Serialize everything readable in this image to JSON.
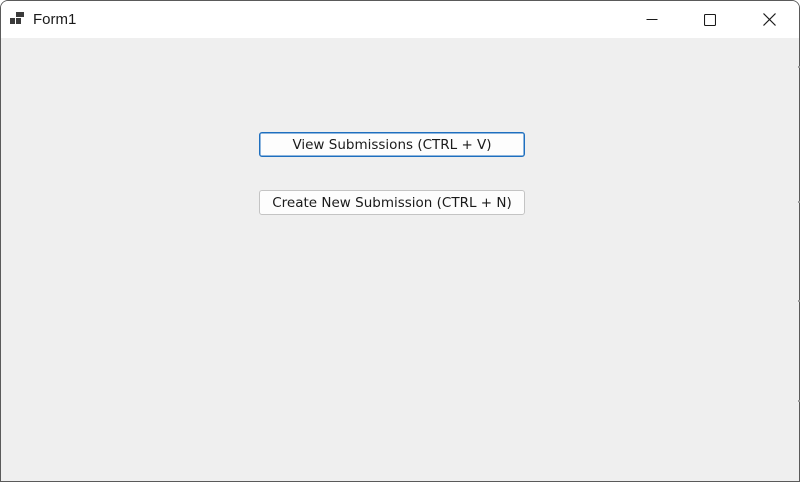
{
  "window": {
    "title": "Form1",
    "icon": "form-app-icon"
  },
  "caption_buttons": {
    "minimize_icon": "minimize-icon",
    "maximize_icon": "maximize-icon",
    "close_icon": "close-icon"
  },
  "main": {
    "view_submissions_label": "View Submissions (CTRL + V)",
    "create_submission_label": "Create New Submission (CTRL + N)"
  },
  "colors": {
    "client_background": "#efefef",
    "titlebar_background": "#ffffff",
    "focus_border": "#1e6fbf"
  }
}
